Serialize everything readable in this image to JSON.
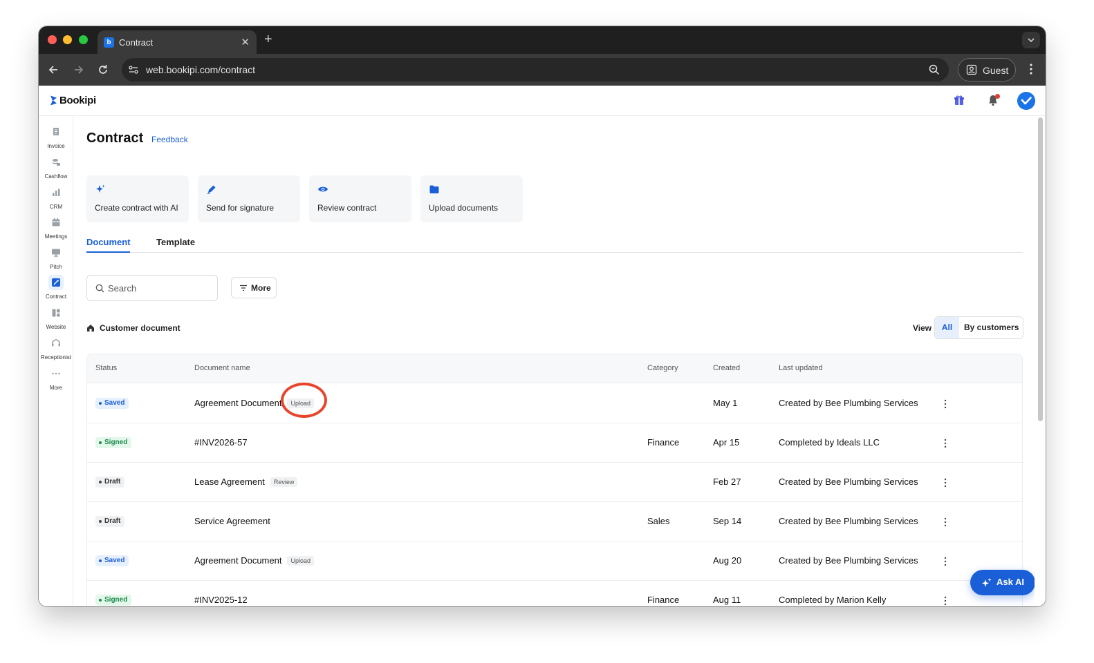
{
  "browser": {
    "tab_title": "Contract",
    "tab_favicon_letter": "b",
    "url": "web.bookipi.com/contract",
    "profile_label": "Guest"
  },
  "app": {
    "logo_text": "Bookipi",
    "brand_color": "#1a5fd8"
  },
  "sidebar": {
    "items": [
      {
        "label": "Invoice",
        "icon": "invoice-icon"
      },
      {
        "label": "Cashflow",
        "icon": "cashflow-icon"
      },
      {
        "label": "CRM",
        "icon": "crm-icon"
      },
      {
        "label": "Meetings",
        "icon": "meetings-icon"
      },
      {
        "label": "Pitch",
        "icon": "pitch-icon"
      },
      {
        "label": "Contract",
        "icon": "contract-icon",
        "active": true
      },
      {
        "label": "Website",
        "icon": "website-icon"
      },
      {
        "label": "Receptionist",
        "icon": "receptionist-icon"
      },
      {
        "label": "More",
        "icon": "more-dots-icon"
      }
    ]
  },
  "page": {
    "title": "Contract",
    "feedback_label": "Feedback"
  },
  "actions": [
    {
      "label": "Create contract with AI",
      "icon": "sparkle-icon"
    },
    {
      "label": "Send for signature",
      "icon": "pen-icon"
    },
    {
      "label": "Review contract",
      "icon": "eye-icon"
    },
    {
      "label": "Upload documents",
      "icon": "folder-icon"
    }
  ],
  "tabs": {
    "document": "Document",
    "template": "Template"
  },
  "filters": {
    "search_placeholder": "Search",
    "more_label": "More"
  },
  "section": {
    "title": "Customer document",
    "view_label": "View",
    "view_all": "All",
    "view_by_customers": "By customers"
  },
  "table": {
    "headers": {
      "status": "Status",
      "name": "Document name",
      "category": "Category",
      "created": "Created",
      "updated": "Last updated"
    },
    "rows": [
      {
        "status": "Saved",
        "status_type": "saved",
        "name": "Agreement Document",
        "tag": "Upload",
        "category": "",
        "created": "May 1",
        "updated": "Created by Bee Plumbing Services"
      },
      {
        "status": "Signed",
        "status_type": "signed",
        "name": "#INV2026-57",
        "tag": "",
        "category": "Finance",
        "created": "Apr 15",
        "updated": "Completed by Ideals LLC"
      },
      {
        "status": "Draft",
        "status_type": "draft",
        "name": "Lease Agreement",
        "tag": "Review",
        "category": "",
        "created": "Feb 27",
        "updated": "Created by Bee Plumbing Services"
      },
      {
        "status": "Draft",
        "status_type": "draft",
        "name": "Service Agreement",
        "tag": "",
        "category": "Sales",
        "created": "Sep 14",
        "updated": "Created by Bee Plumbing Services"
      },
      {
        "status": "Saved",
        "status_type": "saved",
        "name": "Agreement Document",
        "tag": "Upload",
        "category": "",
        "created": "Aug 20",
        "updated": "Created by Bee Plumbing Services"
      },
      {
        "status": "Signed",
        "status_type": "signed",
        "name": "#INV2025-12",
        "tag": "",
        "category": "Finance",
        "created": "Aug 11",
        "updated": "Completed by Marion Kelly"
      }
    ]
  },
  "ask_ai_label": "Ask AI"
}
